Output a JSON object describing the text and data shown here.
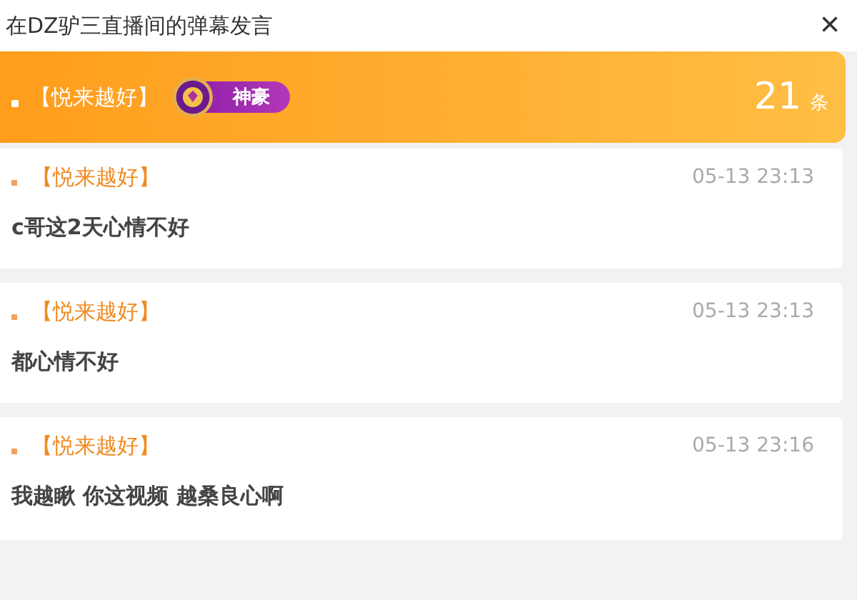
{
  "window": {
    "title": "在DZ驴三直播间的弹幕发言",
    "close": "×"
  },
  "header": {
    "user": "【悦来越好】",
    "badge": "神豪",
    "count": "21",
    "count_unit": "条"
  },
  "messages": [
    {
      "user": "【悦来越好】",
      "time": "05-13 23:13",
      "text": "c哥这2天心情不好"
    },
    {
      "user": "【悦来越好】",
      "time": "05-13 23:13",
      "text": "都心情不好"
    },
    {
      "user": "【悦来越好】",
      "time": "05-13 23:16",
      "text": "我越瞅 你这视频 越桑良心啊"
    }
  ]
}
